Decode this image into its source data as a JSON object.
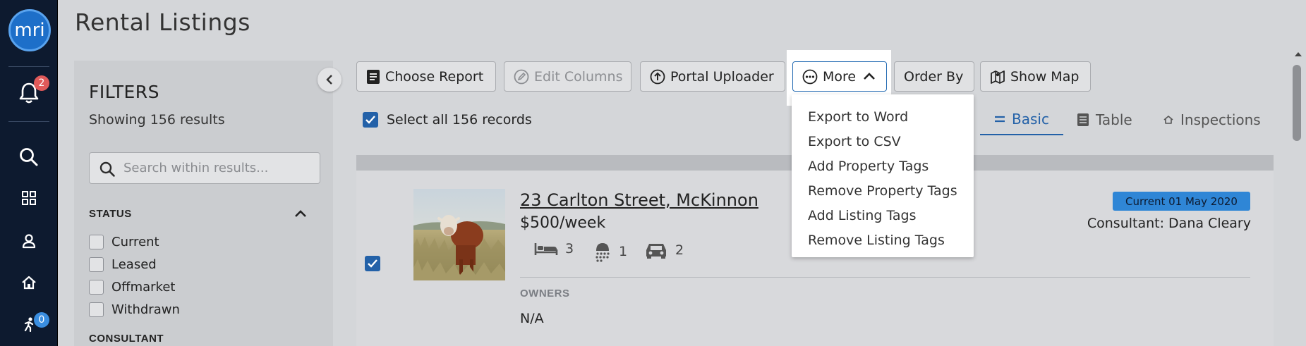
{
  "app": {
    "logo_text": "mri"
  },
  "header": {
    "title": "Rental Listings"
  },
  "nav": {
    "notifications_count": "2",
    "tasks_count": "0"
  },
  "filters": {
    "title": "FILTERS",
    "count_text": "Showing 156 results",
    "search_placeholder": "Search within results...",
    "status_heading": "STATUS",
    "status_options": [
      "Current",
      "Leased",
      "Offmarket",
      "Withdrawn"
    ],
    "consultant_heading": "CONSULTANT"
  },
  "toolbar": {
    "choose_report": "Choose Report",
    "edit_columns": "Edit Columns",
    "portal_uploader": "Portal Uploader",
    "more": "More",
    "order_by": "Order By",
    "show_map": "Show Map"
  },
  "more_menu": {
    "items": [
      "Export to Word",
      "Export to CSV",
      "Add Property Tags",
      "Remove Property Tags",
      "Add Listing Tags",
      "Remove Listing Tags"
    ]
  },
  "select_all": {
    "label": "Select all 156 records",
    "checked": true
  },
  "view_tabs": [
    {
      "label": "Basic",
      "active": true
    },
    {
      "label": "Table",
      "active": false
    },
    {
      "label": "Inspections",
      "active": false
    }
  ],
  "listing": {
    "address": "23 Carlton Street, McKinnon",
    "price": "$500/week",
    "beds": "3",
    "baths": "1",
    "cars": "2",
    "status_badge": "Current 01 May 2020",
    "consultant": "Consultant: Dana Cleary",
    "owners_heading": "OWNERS",
    "owners_value": "N/A",
    "selected": true
  },
  "colors": {
    "nav_bg": "#0d1a2f",
    "accent": "#2361a8",
    "badge": "#2f86d6",
    "notification_badge": "#e05a5a",
    "task_badge": "#3a8ee0"
  }
}
